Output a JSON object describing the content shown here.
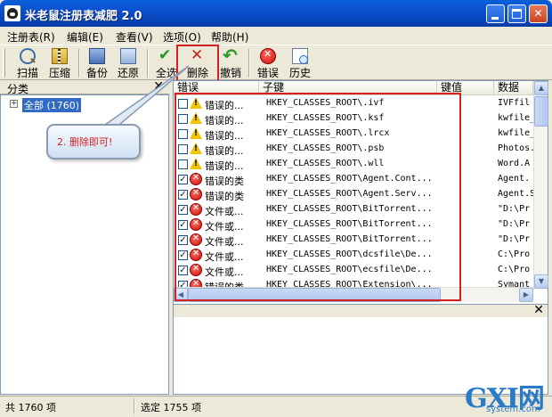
{
  "window": {
    "title": "米老鼠注册表减肥 2.0",
    "min_label": "_",
    "max_label": "□",
    "close_label": "✕"
  },
  "menu": [
    {
      "label": "注册表(R)"
    },
    {
      "label": "编辑(E)"
    },
    {
      "label": "查看(V)"
    },
    {
      "label": "选项(O)"
    },
    {
      "label": "帮助(H)"
    }
  ],
  "toolbar": {
    "scan": "扫描",
    "compress": "压缩",
    "backup": "备份",
    "restore": "还原",
    "select_all": "全选",
    "delete": "删除",
    "undo": "撤销",
    "errors": "错误",
    "history": "历史"
  },
  "left_pane": {
    "header": "分类",
    "close": "✕",
    "tree_root": "全部 (1760)",
    "expander": "+"
  },
  "callout": {
    "text": "2. 删除即可!"
  },
  "list": {
    "columns": [
      "错误",
      "子键",
      "键值",
      "数据"
    ],
    "rows": [
      {
        "checked": false,
        "icon": "warning",
        "error": "错误的...",
        "subkey": "HKEY_CLASSES_ROOT\\.ivf",
        "value": "",
        "data": "IVFfil"
      },
      {
        "checked": false,
        "icon": "warning",
        "error": "错误的...",
        "subkey": "HKEY_CLASSES_ROOT\\.ksf",
        "value": "",
        "data": "kwfile_"
      },
      {
        "checked": false,
        "icon": "warning",
        "error": "错误的...",
        "subkey": "HKEY_CLASSES_ROOT\\.lrcx",
        "value": "",
        "data": "kwfile_"
      },
      {
        "checked": false,
        "icon": "warning",
        "error": "错误的...",
        "subkey": "HKEY_CLASSES_ROOT\\.psb",
        "value": "",
        "data": "Photos."
      },
      {
        "checked": false,
        "icon": "warning",
        "error": "错误的...",
        "subkey": "HKEY_CLASSES_ROOT\\.wll",
        "value": "",
        "data": "Word.A"
      },
      {
        "checked": true,
        "icon": "error",
        "error": "错误的类",
        "subkey": "HKEY_CLASSES_ROOT\\Agent.Cont...",
        "value": "",
        "data": "Agent."
      },
      {
        "checked": true,
        "icon": "error",
        "error": "错误的类",
        "subkey": "HKEY_CLASSES_ROOT\\Agent.Serv...",
        "value": "",
        "data": "Agent.S"
      },
      {
        "checked": true,
        "icon": "error",
        "error": "文件或...",
        "subkey": "HKEY_CLASSES_ROOT\\BitTorrent...",
        "value": "",
        "data": "\"D:\\Pr"
      },
      {
        "checked": true,
        "icon": "error",
        "error": "文件或...",
        "subkey": "HKEY_CLASSES_ROOT\\BitTorrent...",
        "value": "",
        "data": "\"D:\\Pr"
      },
      {
        "checked": true,
        "icon": "error",
        "error": "文件或...",
        "subkey": "HKEY_CLASSES_ROOT\\BitTorrent...",
        "value": "",
        "data": "\"D:\\Pr"
      },
      {
        "checked": true,
        "icon": "error",
        "error": "文件或...",
        "subkey": "HKEY_CLASSES_ROOT\\dcsfile\\De...",
        "value": "",
        "data": "C:\\Pro"
      },
      {
        "checked": true,
        "icon": "error",
        "error": "文件或...",
        "subkey": "HKEY_CLASSES_ROOT\\ecsfile\\De...",
        "value": "",
        "data": "C:\\Pro"
      },
      {
        "checked": true,
        "icon": "error",
        "error": "错误的类",
        "subkey": "HKEY_CLASSES_ROOT\\Extension\\...",
        "value": "",
        "data": "Symant"
      }
    ]
  },
  "detail_pane": {
    "close": "✕"
  },
  "status": {
    "total": "共 1760 项",
    "selected": "选定 1755 项"
  },
  "watermark": {
    "main": "GXI网",
    "sub": "system.com"
  },
  "colors": {
    "accent_red": "#d42020",
    "title_blue": "#0b4fcf",
    "selection_blue": "#316ac5"
  }
}
